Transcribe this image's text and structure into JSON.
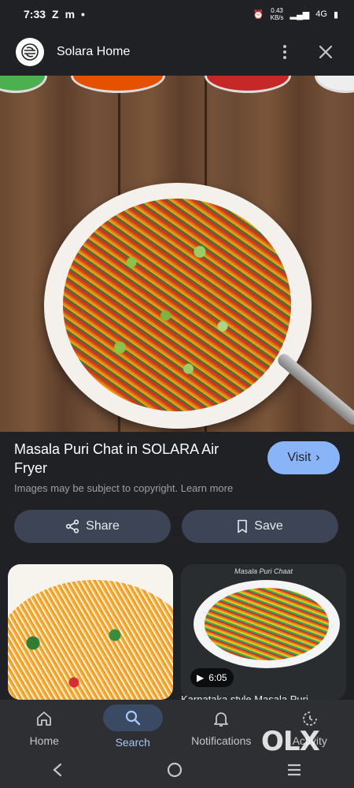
{
  "status_bar": {
    "time": "7:33",
    "left_icons": [
      "Z",
      "m",
      "•"
    ],
    "network_speed": [
      "0.43",
      "KB/s"
    ],
    "network": "4G"
  },
  "header": {
    "title": "Solara Home",
    "logo_icon": "solara-logo-icon"
  },
  "result": {
    "title": "Masala Puri Chat in SOLARA Air Fryer",
    "visit_label": "Visit",
    "copyright": "Images may be subject to copyright. Learn more"
  },
  "actions": {
    "share_label": "Share",
    "save_label": "Save"
  },
  "related": [
    {
      "label": ""
    },
    {
      "label": "Masala Puri Chaat",
      "duration": "6:05",
      "caption": "Karnataka style Masala Puri"
    }
  ],
  "bottom_nav": [
    {
      "label": "Home",
      "icon": "home-icon"
    },
    {
      "label": "Search",
      "icon": "search-icon",
      "active": true
    },
    {
      "label": "Notifications",
      "icon": "bell-icon"
    },
    {
      "label": "Activity",
      "icon": "activity-icon"
    }
  ],
  "colors": {
    "background": "#202124",
    "accent": "#8ab4f8",
    "chip": "#3c4455"
  },
  "watermark": "OLX"
}
